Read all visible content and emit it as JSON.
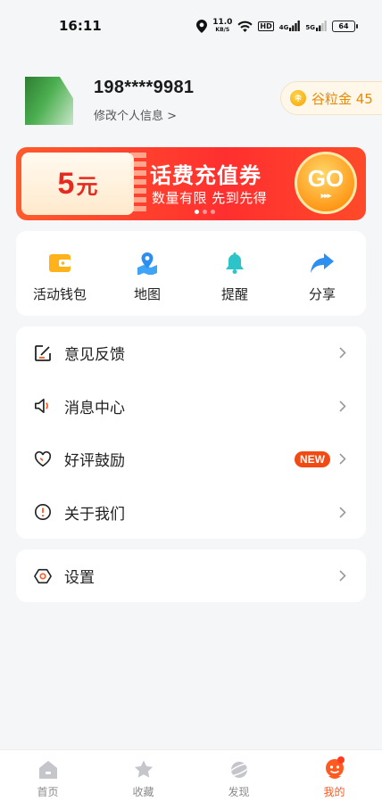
{
  "status_bar": {
    "time": "16:11",
    "net_speed": "11.0",
    "net_unit": "KB/S",
    "hd_label": "HD",
    "sig1": "4G",
    "sig2": "5G",
    "battery": "64"
  },
  "profile": {
    "phone": "198****9981",
    "edit_link": "修改个人信息 >",
    "coin_label": "谷粒金 45"
  },
  "banner": {
    "amount": "5",
    "unit": "元",
    "title": "话费充值券",
    "subtitle": "数量有限 先到先得",
    "go_label": "GO",
    "go_arrows": "▸▸▸",
    "page_count": 3,
    "active_page": 0
  },
  "shortcuts": [
    {
      "label": "活动钱包",
      "icon": "wallet-icon"
    },
    {
      "label": "地图",
      "icon": "map-icon"
    },
    {
      "label": "提醒",
      "icon": "bell-icon"
    },
    {
      "label": "分享",
      "icon": "share-icon"
    }
  ],
  "menu": [
    {
      "label": "意见反馈",
      "icon": "edit-icon"
    },
    {
      "label": "消息中心",
      "icon": "speaker-icon"
    },
    {
      "label": "好评鼓励",
      "icon": "heart-icon",
      "badge": "NEW"
    },
    {
      "label": "关于我们",
      "icon": "info-icon"
    }
  ],
  "settings": {
    "label": "设置",
    "icon": "settings-icon"
  },
  "tabs": [
    {
      "label": "首页",
      "icon": "home-icon"
    },
    {
      "label": "收藏",
      "icon": "star-icon"
    },
    {
      "label": "发现",
      "icon": "planet-icon"
    },
    {
      "label": "我的",
      "icon": "profile-icon",
      "active": true
    }
  ],
  "colors": {
    "accent": "#ff5a1f",
    "banner_red": "#ff2f2f",
    "coin_orange": "#e98a06",
    "new_badge": "#f24a14"
  }
}
